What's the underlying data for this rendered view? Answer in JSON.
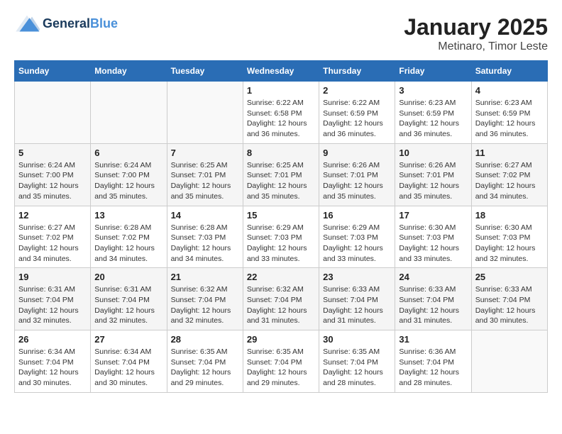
{
  "logo": {
    "line1": "General",
    "line2": "Blue"
  },
  "title": "January 2025",
  "subtitle": "Metinaro, Timor Leste",
  "header_days": [
    "Sunday",
    "Monday",
    "Tuesday",
    "Wednesday",
    "Thursday",
    "Friday",
    "Saturday"
  ],
  "weeks": [
    [
      {
        "day": "",
        "sunrise": "",
        "sunset": "",
        "daylight": ""
      },
      {
        "day": "",
        "sunrise": "",
        "sunset": "",
        "daylight": ""
      },
      {
        "day": "",
        "sunrise": "",
        "sunset": "",
        "daylight": ""
      },
      {
        "day": "1",
        "sunrise": "Sunrise: 6:22 AM",
        "sunset": "Sunset: 6:58 PM",
        "daylight": "Daylight: 12 hours and 36 minutes."
      },
      {
        "day": "2",
        "sunrise": "Sunrise: 6:22 AM",
        "sunset": "Sunset: 6:59 PM",
        "daylight": "Daylight: 12 hours and 36 minutes."
      },
      {
        "day": "3",
        "sunrise": "Sunrise: 6:23 AM",
        "sunset": "Sunset: 6:59 PM",
        "daylight": "Daylight: 12 hours and 36 minutes."
      },
      {
        "day": "4",
        "sunrise": "Sunrise: 6:23 AM",
        "sunset": "Sunset: 6:59 PM",
        "daylight": "Daylight: 12 hours and 36 minutes."
      }
    ],
    [
      {
        "day": "5",
        "sunrise": "Sunrise: 6:24 AM",
        "sunset": "Sunset: 7:00 PM",
        "daylight": "Daylight: 12 hours and 35 minutes."
      },
      {
        "day": "6",
        "sunrise": "Sunrise: 6:24 AM",
        "sunset": "Sunset: 7:00 PM",
        "daylight": "Daylight: 12 hours and 35 minutes."
      },
      {
        "day": "7",
        "sunrise": "Sunrise: 6:25 AM",
        "sunset": "Sunset: 7:01 PM",
        "daylight": "Daylight: 12 hours and 35 minutes."
      },
      {
        "day": "8",
        "sunrise": "Sunrise: 6:25 AM",
        "sunset": "Sunset: 7:01 PM",
        "daylight": "Daylight: 12 hours and 35 minutes."
      },
      {
        "day": "9",
        "sunrise": "Sunrise: 6:26 AM",
        "sunset": "Sunset: 7:01 PM",
        "daylight": "Daylight: 12 hours and 35 minutes."
      },
      {
        "day": "10",
        "sunrise": "Sunrise: 6:26 AM",
        "sunset": "Sunset: 7:01 PM",
        "daylight": "Daylight: 12 hours and 35 minutes."
      },
      {
        "day": "11",
        "sunrise": "Sunrise: 6:27 AM",
        "sunset": "Sunset: 7:02 PM",
        "daylight": "Daylight: 12 hours and 34 minutes."
      }
    ],
    [
      {
        "day": "12",
        "sunrise": "Sunrise: 6:27 AM",
        "sunset": "Sunset: 7:02 PM",
        "daylight": "Daylight: 12 hours and 34 minutes."
      },
      {
        "day": "13",
        "sunrise": "Sunrise: 6:28 AM",
        "sunset": "Sunset: 7:02 PM",
        "daylight": "Daylight: 12 hours and 34 minutes."
      },
      {
        "day": "14",
        "sunrise": "Sunrise: 6:28 AM",
        "sunset": "Sunset: 7:03 PM",
        "daylight": "Daylight: 12 hours and 34 minutes."
      },
      {
        "day": "15",
        "sunrise": "Sunrise: 6:29 AM",
        "sunset": "Sunset: 7:03 PM",
        "daylight": "Daylight: 12 hours and 33 minutes."
      },
      {
        "day": "16",
        "sunrise": "Sunrise: 6:29 AM",
        "sunset": "Sunset: 7:03 PM",
        "daylight": "Daylight: 12 hours and 33 minutes."
      },
      {
        "day": "17",
        "sunrise": "Sunrise: 6:30 AM",
        "sunset": "Sunset: 7:03 PM",
        "daylight": "Daylight: 12 hours and 33 minutes."
      },
      {
        "day": "18",
        "sunrise": "Sunrise: 6:30 AM",
        "sunset": "Sunset: 7:03 PM",
        "daylight": "Daylight: 12 hours and 32 minutes."
      }
    ],
    [
      {
        "day": "19",
        "sunrise": "Sunrise: 6:31 AM",
        "sunset": "Sunset: 7:04 PM",
        "daylight": "Daylight: 12 hours and 32 minutes."
      },
      {
        "day": "20",
        "sunrise": "Sunrise: 6:31 AM",
        "sunset": "Sunset: 7:04 PM",
        "daylight": "Daylight: 12 hours and 32 minutes."
      },
      {
        "day": "21",
        "sunrise": "Sunrise: 6:32 AM",
        "sunset": "Sunset: 7:04 PM",
        "daylight": "Daylight: 12 hours and 32 minutes."
      },
      {
        "day": "22",
        "sunrise": "Sunrise: 6:32 AM",
        "sunset": "Sunset: 7:04 PM",
        "daylight": "Daylight: 12 hours and 31 minutes."
      },
      {
        "day": "23",
        "sunrise": "Sunrise: 6:33 AM",
        "sunset": "Sunset: 7:04 PM",
        "daylight": "Daylight: 12 hours and 31 minutes."
      },
      {
        "day": "24",
        "sunrise": "Sunrise: 6:33 AM",
        "sunset": "Sunset: 7:04 PM",
        "daylight": "Daylight: 12 hours and 31 minutes."
      },
      {
        "day": "25",
        "sunrise": "Sunrise: 6:33 AM",
        "sunset": "Sunset: 7:04 PM",
        "daylight": "Daylight: 12 hours and 30 minutes."
      }
    ],
    [
      {
        "day": "26",
        "sunrise": "Sunrise: 6:34 AM",
        "sunset": "Sunset: 7:04 PM",
        "daylight": "Daylight: 12 hours and 30 minutes."
      },
      {
        "day": "27",
        "sunrise": "Sunrise: 6:34 AM",
        "sunset": "Sunset: 7:04 PM",
        "daylight": "Daylight: 12 hours and 30 minutes."
      },
      {
        "day": "28",
        "sunrise": "Sunrise: 6:35 AM",
        "sunset": "Sunset: 7:04 PM",
        "daylight": "Daylight: 12 hours and 29 minutes."
      },
      {
        "day": "29",
        "sunrise": "Sunrise: 6:35 AM",
        "sunset": "Sunset: 7:04 PM",
        "daylight": "Daylight: 12 hours and 29 minutes."
      },
      {
        "day": "30",
        "sunrise": "Sunrise: 6:35 AM",
        "sunset": "Sunset: 7:04 PM",
        "daylight": "Daylight: 12 hours and 28 minutes."
      },
      {
        "day": "31",
        "sunrise": "Sunrise: 6:36 AM",
        "sunset": "Sunset: 7:04 PM",
        "daylight": "Daylight: 12 hours and 28 minutes."
      },
      {
        "day": "",
        "sunrise": "",
        "sunset": "",
        "daylight": ""
      }
    ]
  ]
}
